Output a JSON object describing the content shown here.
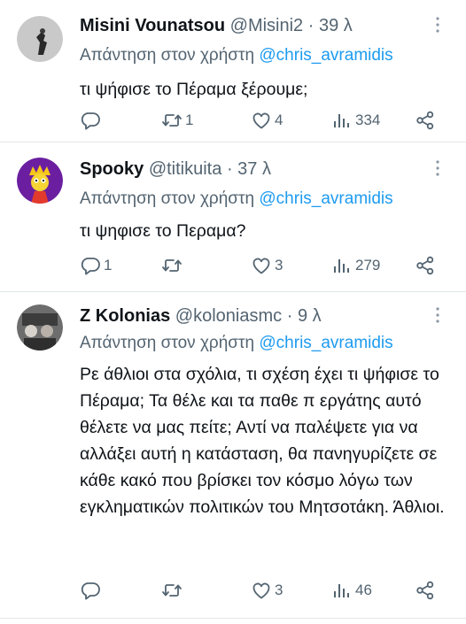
{
  "tweets": [
    {
      "name": "Misini Vounatsou",
      "handle": "@Misini2",
      "sep": "·",
      "time": "39 λ",
      "reply_prefix": "Απάντηση στον χρήστη",
      "reply_to": "@chris_avramidis",
      "text": "τι ψήφισε το Πέραμα ξέρουμε;",
      "counts": {
        "replies": "",
        "retweets": "1",
        "likes": "4",
        "views": "334"
      },
      "avatar_color": "#c9c9c9"
    },
    {
      "name": "Spooky",
      "handle": "@titikuita",
      "sep": "·",
      "time": "37 λ",
      "reply_prefix": "Απάντηση στον χρήστη",
      "reply_to": "@chris_avramidis",
      "text": "τι ψηφισε το Περαμα?",
      "counts": {
        "replies": "1",
        "retweets": "",
        "likes": "3",
        "views": "279"
      },
      "avatar_color": "#6b1fa0"
    },
    {
      "name": "Z Kolonias",
      "handle": "@koloniasmc",
      "sep": "·",
      "time": "9 λ",
      "reply_prefix": "Απάντηση στον χρήστη",
      "reply_to": "@chris_avramidis",
      "text": "Ρε άθλιοι στα σχόλια, τι σχέση έχει τι ψήφισε το Πέραμα; Τα θέλε και τα παθε π εργάτης αυτό θέλετε να μας πείτε;  Αντί να παλέψετε για να αλλάξει αυτή η κατάσταση, θα πανηγυρίζετε σε κάθε κακό που βρίσκει τον κόσμο λόγω των εγκληματικών πολιτικών του Μητσοτάκη. Άθλιοι.",
      "counts": {
        "replies": "",
        "retweets": "",
        "likes": "3",
        "views": "46"
      },
      "avatar_color": "#6d6d6d"
    }
  ],
  "icons": {
    "reply": "reply-icon",
    "retweet": "retweet-icon",
    "like": "heart-icon",
    "views": "views-icon",
    "share": "share-icon",
    "more": "more-icon"
  },
  "colors": {
    "text": "#0f1419",
    "secondary": "#536471",
    "mention": "#1d9bf0",
    "divider": "#e3e6e9"
  }
}
